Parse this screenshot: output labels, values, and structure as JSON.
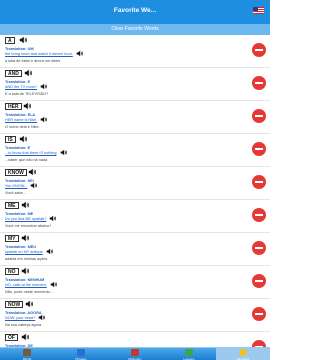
{
  "header": {
    "title": "Favorite We...",
    "flag_icon": "us-flag-icon"
  },
  "clear_label": "Clear Favorite Words",
  "items": [
    {
      "word": "A",
      "translation_label": "Translation: UM",
      "example": "the living room and watch it eleven hour.",
      "example_translation": "a sala de estar e ahora um deles"
    },
    {
      "word": "AND",
      "translation_label": "Translation: E",
      "example": "AND the TV room?",
      "example_translation": "E a sala de TELEVISÃO?"
    },
    {
      "word": "HER",
      "translation_label": "Translation: ELA",
      "example": "HER name is Nike.",
      "example_translation": "O nome dela é Nike."
    },
    {
      "word": "IS",
      "translation_label": "Translation: É",
      "example": "...to know that there IS nothing",
      "example_translation": "...saber que não há nada"
    },
    {
      "word": "KNOW",
      "translation_label": "Translation: SEI",
      "example": "You KNOW...",
      "example_translation": "Você sabe..."
    },
    {
      "word": "ME",
      "translation_label": "Translation: ME",
      "example": "Do you find ME spatiab?",
      "example_translation": "Você me encontrar abaixo?"
    },
    {
      "word": "MY",
      "translation_label": "Translation: MEU",
      "example": "spatiab on MY antique",
      "example_translation": "adabia em minhas ações"
    },
    {
      "word": "NO",
      "translation_label": "Translation: NENHUM",
      "example": "NO, calls at the moment.",
      "example_translation": "Não, pode neste momento..."
    },
    {
      "word": "NOW",
      "translation_label": "Translation: AGORA",
      "example": "NOW, your head?",
      "example_translation": "Na sua cabeça agora"
    },
    {
      "word": "OF",
      "translation_label": "Translation: DE",
      "example": "This is an old friend OF Monica's",
      "example_translation": ""
    }
  ],
  "tabs": [
    {
      "label": "Words",
      "icon": "book-icon",
      "color": "#7a5a3a"
    },
    {
      "label": "Phrases",
      "icon": "tag-icon",
      "color": "#2a6fd0"
    },
    {
      "label": "Dictionary",
      "icon": "dictionary-icon",
      "color": "#c23a2a"
    },
    {
      "label": "Lessons",
      "icon": "lessons-icon",
      "color": "#3aa84a"
    },
    {
      "label": "Favorites",
      "icon": "star-icon",
      "color": "#f2c21c"
    }
  ],
  "active_tab": 4,
  "colors": {
    "accent": "#1e8fe0",
    "delete": "#e53935",
    "link": "#1e5fbf"
  }
}
